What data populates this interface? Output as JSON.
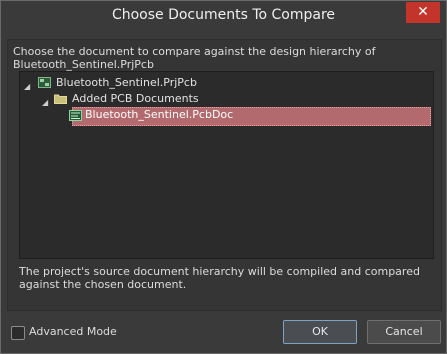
{
  "window": {
    "title": "Choose Documents To Compare",
    "close_symbol": "✕"
  },
  "description": {
    "line1": "Choose the document to compare against the design hierarchy of",
    "line2": "Bluetooth_Sentinel.PrjPcb"
  },
  "tree": {
    "items": [
      {
        "label": "Bluetooth_Sentinel.PrjPcb",
        "icon": "pcb-project-icon"
      },
      {
        "label": "Added PCB Documents",
        "icon": "folder-icon"
      },
      {
        "label": "Bluetooth_Sentinel.PcbDoc",
        "icon": "pcb-document-icon",
        "selected": true
      }
    ]
  },
  "footer": {
    "line1": "The project's source document hierarchy will be compiled and compared",
    "line2": "against the chosen document."
  },
  "advanced_mode": {
    "label": "Advanced Mode",
    "checked": false
  },
  "buttons": {
    "ok": "OK",
    "cancel": "Cancel"
  },
  "colors": {
    "selection": "#b36a6e",
    "close_button": "#c3352b",
    "background": "#3a3a3a"
  }
}
